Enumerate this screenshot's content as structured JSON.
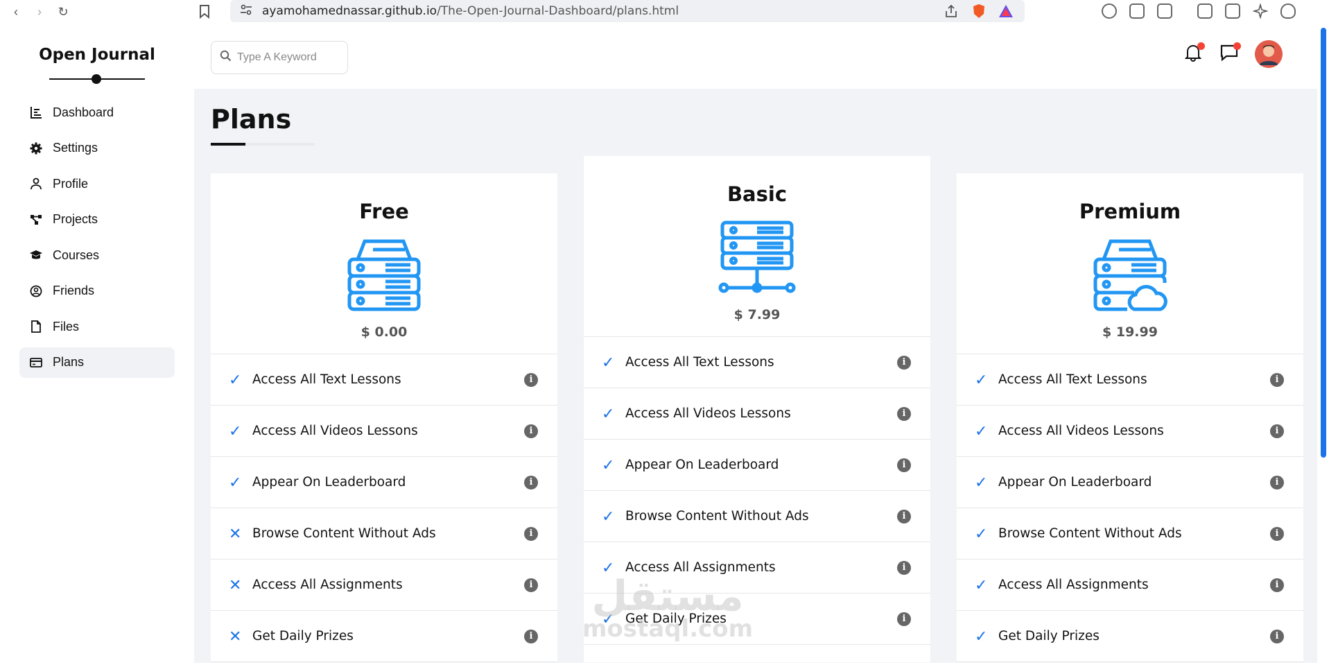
{
  "browser": {
    "url_host": "ayamohamednassar.github.io",
    "url_path": "/The-Open-Journal-Dashboard/plans.html"
  },
  "sidebar": {
    "logo": "Open Journal",
    "items": [
      {
        "label": "Dashboard",
        "icon": "chart-icon"
      },
      {
        "label": "Settings",
        "icon": "gear-icon"
      },
      {
        "label": "Profile",
        "icon": "user-icon"
      },
      {
        "label": "Projects",
        "icon": "diagram-icon"
      },
      {
        "label": "Courses",
        "icon": "graduation-cap-icon"
      },
      {
        "label": "Friends",
        "icon": "user-circle-icon"
      },
      {
        "label": "Files",
        "icon": "file-icon"
      },
      {
        "label": "Plans",
        "icon": "credit-card-icon",
        "active": true
      }
    ]
  },
  "header": {
    "search_placeholder": "Type A Keyword"
  },
  "page": {
    "title": "Plans"
  },
  "plans": [
    {
      "name": "Free",
      "price": "$ 0.00",
      "icon": "server-icon",
      "features": [
        {
          "text": "Access All Text Lessons",
          "included": true
        },
        {
          "text": "Access All Videos Lessons",
          "included": true
        },
        {
          "text": "Appear On Leaderboard",
          "included": true
        },
        {
          "text": "Browse Content Without Ads",
          "included": false
        },
        {
          "text": "Access All Assignments",
          "included": false
        },
        {
          "text": "Get Daily Prizes",
          "included": false
        }
      ]
    },
    {
      "name": "Basic",
      "price": "$ 7.99",
      "icon": "server-network-icon",
      "features": [
        {
          "text": "Access All Text Lessons",
          "included": true
        },
        {
          "text": "Access All Videos Lessons",
          "included": true
        },
        {
          "text": "Appear On Leaderboard",
          "included": true
        },
        {
          "text": "Browse Content Without Ads",
          "included": true
        },
        {
          "text": "Access All Assignments",
          "included": true
        },
        {
          "text": "Get Daily Prizes",
          "included": true
        }
      ]
    },
    {
      "name": "Premium",
      "price": "$ 19.99",
      "icon": "server-cloud-icon",
      "features": [
        {
          "text": "Access All Text Lessons",
          "included": true
        },
        {
          "text": "Access All Videos Lessons",
          "included": true
        },
        {
          "text": "Appear On Leaderboard",
          "included": true
        },
        {
          "text": "Browse Content Without Ads",
          "included": true
        },
        {
          "text": "Access All Assignments",
          "included": true
        },
        {
          "text": "Get Daily Prizes",
          "included": true
        }
      ]
    }
  ],
  "watermark": {
    "line1": "مستقل",
    "line2": "mostaql.com"
  },
  "colors": {
    "accent": "#1a73e8",
    "badge": "#f44336",
    "text": "#111111",
    "background": "#f1f3f6"
  }
}
